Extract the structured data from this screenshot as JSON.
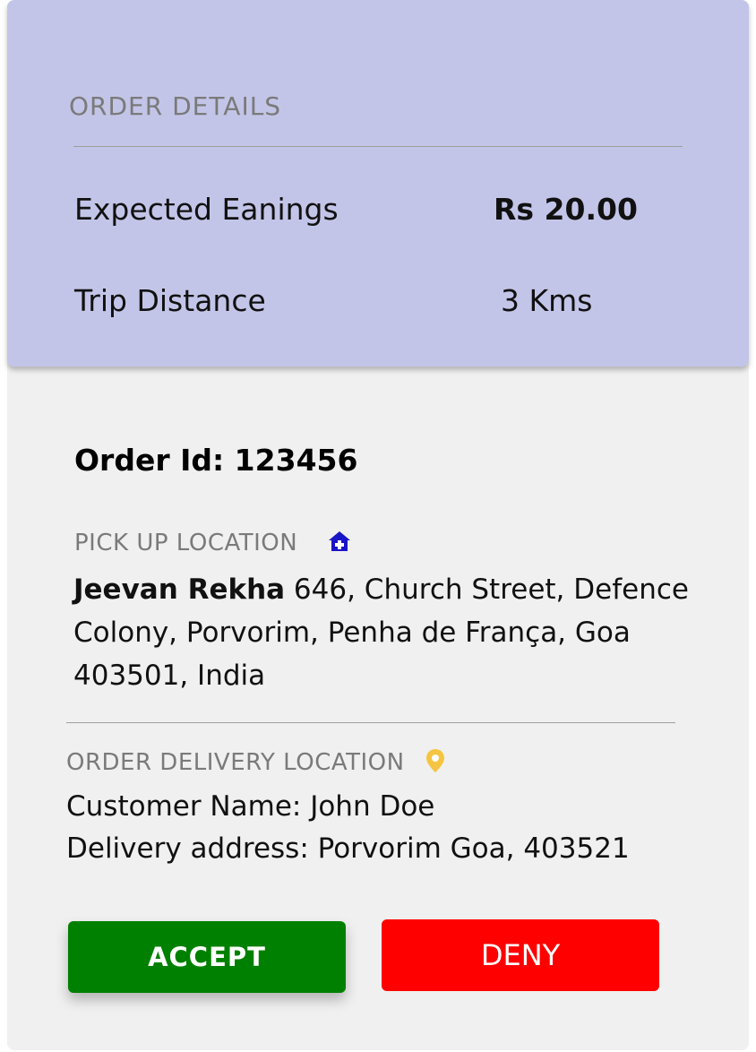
{
  "order_details": {
    "title": "ORDER DETAILS",
    "earnings_label": "Expected Eanings",
    "earnings_value": "Rs 20.00",
    "distance_label": "Trip Distance",
    "distance_value": "3 Kms"
  },
  "order": {
    "id_label": "Order Id: 123456"
  },
  "pickup": {
    "label": "PICK UP LOCATION",
    "icon": "home-medical-icon",
    "place_name": "Jeevan Rekha",
    "address": " 646, Church Street, Defence Colony, Porvorim, Penha de França, Goa 403501, India"
  },
  "delivery": {
    "label": "ORDER DELIVERY LOCATION",
    "icon": "location-pin-icon",
    "customer_label": "Customer Name: John Doe",
    "address_label": "Delivery address:",
    "address_value": " Porvorim Goa, 403521"
  },
  "actions": {
    "accept_label": "ACCEPT",
    "deny_label": "DENY"
  },
  "colors": {
    "header_bg": "#c3c5e8",
    "accept": "#008000",
    "deny": "#ff0000",
    "pickup_icon": "#1a14c8",
    "pin_icon": "#f5c542"
  }
}
